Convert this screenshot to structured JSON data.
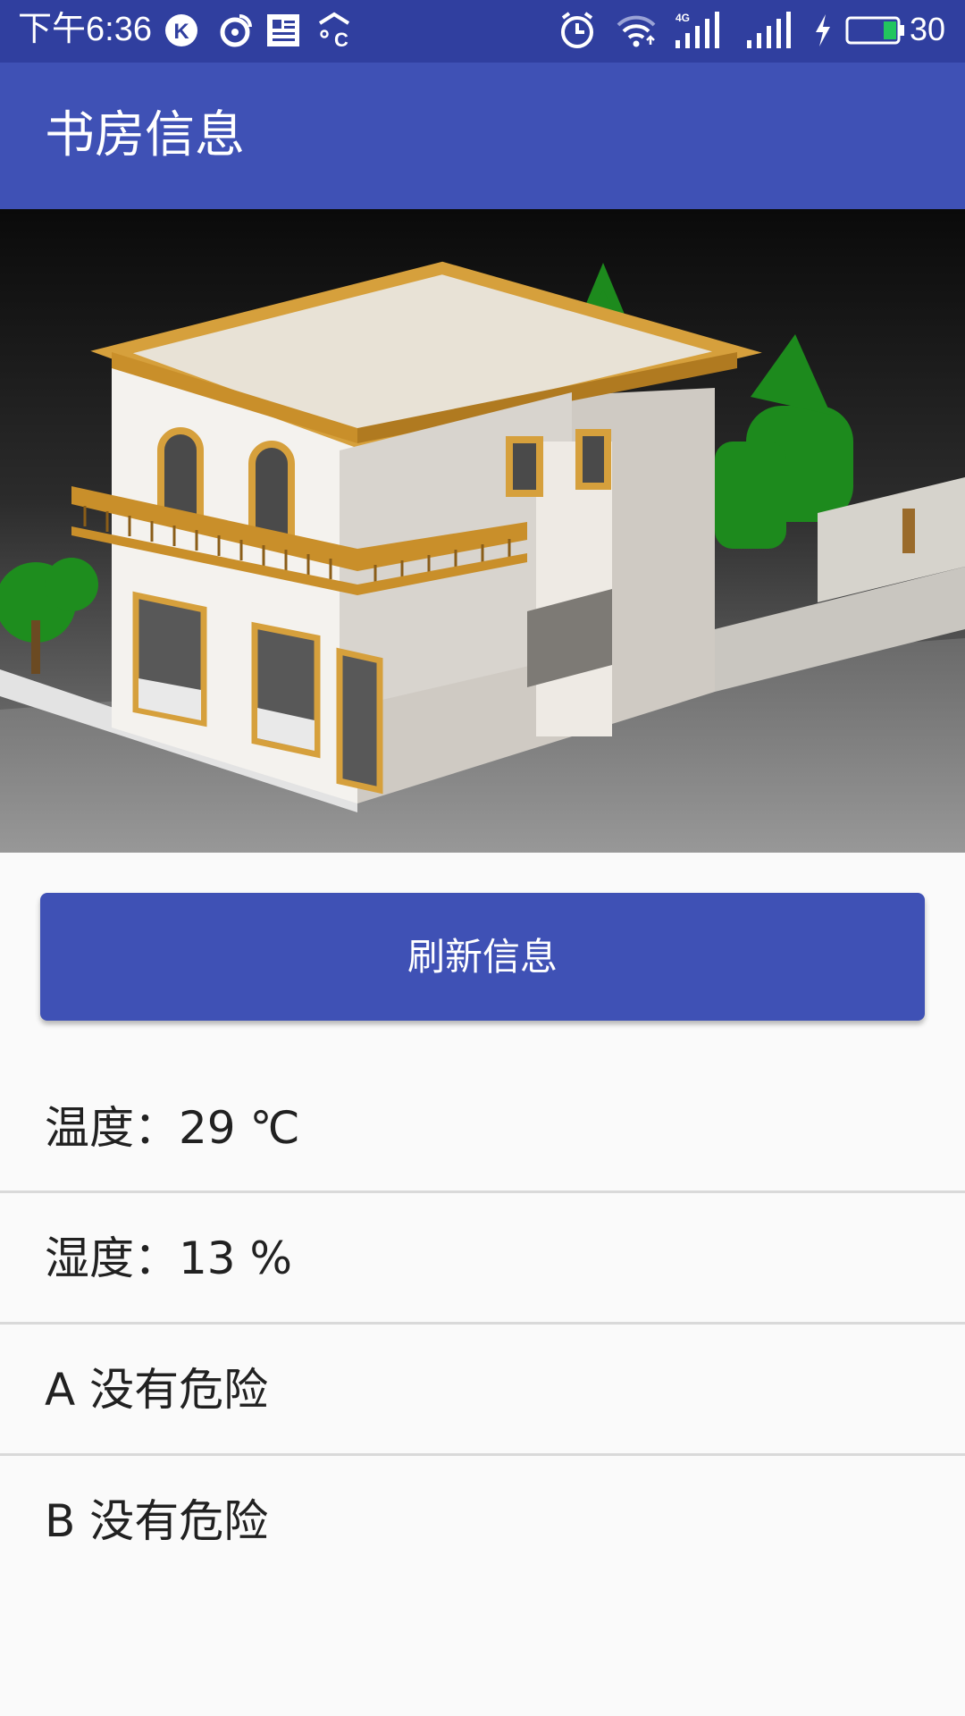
{
  "status_bar": {
    "time": "下午6:36",
    "battery_level": "30",
    "network": "4G",
    "icons": [
      "k-app-icon",
      "weibo-icon",
      "news-icon",
      "weather-icon",
      "alarm-icon",
      "wifi-icon",
      "signal-icon",
      "signal-icon-2",
      "charging-icon",
      "battery-icon"
    ]
  },
  "app_bar": {
    "title": "书房信息"
  },
  "hero": {
    "image": "house-illustration"
  },
  "refresh_button": {
    "label": "刷新信息"
  },
  "info": {
    "temperature": "温度：29 ℃",
    "humidity": "湿度：13 %",
    "sensor_a": "A 没有危险",
    "sensor_b": "B 没有危险"
  },
  "colors": {
    "primary": "#3f51b5",
    "primary_dark": "#303f9f",
    "background": "#fafafa",
    "text": "#212121",
    "divider": "#d9d9d9"
  }
}
